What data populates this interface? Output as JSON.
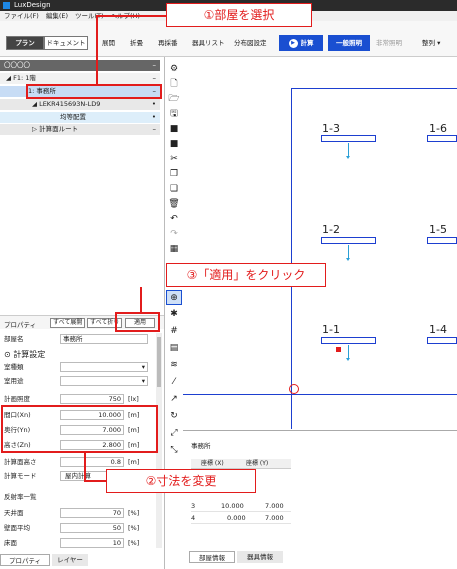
{
  "app": {
    "title": "LuxDesign"
  },
  "menu": [
    "ファイル(F)",
    "編集(E)",
    "ツール(T)",
    "ヘルプ(H)"
  ],
  "toolbar": {
    "plan": "プラン",
    "document": "ドキュメント",
    "items": [
      "展開",
      "折畳",
      "再採番",
      "器具リスト",
      "分布図設定"
    ],
    "calc": "計算",
    "general": "一般照明",
    "safety": "非常照明",
    "sort": "整列"
  },
  "tree": {
    "root": "〇〇〇〇",
    "floor": "F1: 1階",
    "room": "1: 事務所",
    "fixture": "LEKR415693N-LD9",
    "layout": "均等配置",
    "route": "計算面ルート"
  },
  "props": {
    "header": "プロパティ",
    "expand_all": "すべて展開",
    "collapse_all": "すべて折り",
    "apply": "適用",
    "room_name_label": "部屋名",
    "room_name": "事務所",
    "section": "計算設定",
    "type_label": "室種類",
    "use_label": "室用途",
    "lux_label": "計画照度",
    "lux": "750",
    "lux_unit": "[lx]",
    "xn_label": "間口(Xn)",
    "xn": "10.000",
    "xn_unit": "[m]",
    "yn_label": "奥行(Yn)",
    "yn": "7.000",
    "yn_unit": "[m]",
    "zn_label": "高さ(Zn)",
    "zn": "2.800",
    "zn_unit": "[m]",
    "calc_height_label": "計算面高さ",
    "calc_height": "0.8",
    "calc_height_unit": "[m]",
    "mode_label": "計算モード",
    "mode": "屋内計算",
    "refl_label": "反射率一覧",
    "ceiling_label": "天井面",
    "ceiling": "70",
    "ceiling_unit": "[%]",
    "wall_label": "壁面平均",
    "wall": "50",
    "wall_unit": "[%]",
    "floor_label": "床面",
    "floor": "10",
    "floor_unit": "[%]"
  },
  "left_tabs": [
    "プロパティ",
    "レイヤー"
  ],
  "canvas": {
    "labels": [
      "1-3",
      "1-6",
      "1-2",
      "1-5",
      "1-1",
      "1-4"
    ]
  },
  "bottom": {
    "title": "事務所",
    "col_x": "座標 (X)",
    "col_y": "座標 (Y)",
    "rows": [
      {
        "no": "3",
        "x": "10.000",
        "y": "7.000"
      },
      {
        "no": "4",
        "x": "0.000",
        "y": "7.000"
      }
    ],
    "tabs": [
      "部屋情報",
      "器具情報"
    ]
  },
  "callouts": {
    "c1": "①部屋を選択",
    "c2": "②寸法を変更",
    "c3": "③「適用」をクリック"
  },
  "colors": {
    "accent": "#1a4fd1",
    "callout": "#e21c1c",
    "lines": "#1d3fd0"
  }
}
